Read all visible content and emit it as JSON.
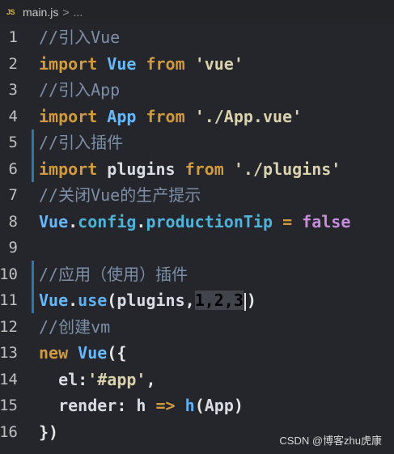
{
  "breadcrumb": {
    "file_icon": "JS",
    "file": "main.js",
    "sep": ">",
    "more": "..."
  },
  "lines": [
    {
      "n": "1",
      "tokens": [
        [
          "cmt",
          "//引入Vue"
        ]
      ]
    },
    {
      "n": "2",
      "tokens": [
        [
          "kw",
          "import"
        ],
        [
          "id",
          " "
        ],
        [
          "cls",
          "Vue"
        ],
        [
          "id",
          " "
        ],
        [
          "kw",
          "from"
        ],
        [
          "id",
          " "
        ],
        [
          "str",
          "'vue'"
        ]
      ]
    },
    {
      "n": "3",
      "tokens": [
        [
          "cmt",
          "//引入App"
        ]
      ]
    },
    {
      "n": "4",
      "tokens": [
        [
          "kw",
          "import"
        ],
        [
          "id",
          " "
        ],
        [
          "cls",
          "App"
        ],
        [
          "id",
          " "
        ],
        [
          "kw",
          "from"
        ],
        [
          "id",
          " "
        ],
        [
          "str",
          "'./App.vue'"
        ]
      ]
    },
    {
      "n": "5",
      "tokens": [
        [
          "cmt",
          "//引入插件"
        ]
      ]
    },
    {
      "n": "6",
      "tokens": [
        [
          "kw",
          "import"
        ],
        [
          "id",
          " "
        ],
        [
          "id",
          "plugins"
        ],
        [
          "id",
          " "
        ],
        [
          "kw",
          "from"
        ],
        [
          "id",
          " "
        ],
        [
          "str",
          "'./plugins'"
        ]
      ]
    },
    {
      "n": "7",
      "tokens": [
        [
          "cmt",
          "//关闭Vue的生产提示"
        ]
      ]
    },
    {
      "n": "8",
      "tokens": [
        [
          "cls",
          "Vue"
        ],
        [
          "pun",
          "."
        ],
        [
          "prop",
          "config"
        ],
        [
          "pun",
          "."
        ],
        [
          "prop",
          "productionTip"
        ],
        [
          "id",
          " "
        ],
        [
          "op",
          "="
        ],
        [
          "id",
          " "
        ],
        [
          "bool",
          "false"
        ]
      ]
    },
    {
      "n": "9",
      "tokens": []
    },
    {
      "n": "10",
      "tokens": [
        [
          "cmt",
          "//应用（使用）插件"
        ]
      ]
    },
    {
      "n": "11",
      "tokens": [
        [
          "cls",
          "Vue"
        ],
        [
          "pun",
          "."
        ],
        [
          "fn",
          "use"
        ],
        [
          "pun",
          "("
        ],
        [
          "id",
          "plugins"
        ],
        [
          "pun",
          ","
        ],
        [
          "sel",
          "1,2,3"
        ],
        [
          "cursor",
          ""
        ],
        [
          "pun",
          ")"
        ]
      ]
    },
    {
      "n": "12",
      "tokens": [
        [
          "cmt",
          "//创建vm"
        ]
      ]
    },
    {
      "n": "13",
      "tokens": [
        [
          "kw",
          "new"
        ],
        [
          "id",
          " "
        ],
        [
          "cls",
          "Vue"
        ],
        [
          "pun",
          "({"
        ]
      ]
    },
    {
      "n": "14",
      "tokens": [
        [
          "id",
          "  el"
        ],
        [
          "pun",
          ":"
        ],
        [
          "str",
          "'#app'"
        ],
        [
          "pun",
          ","
        ]
      ]
    },
    {
      "n": "15",
      "tokens": [
        [
          "id",
          "  render"
        ],
        [
          "pun",
          ":"
        ],
        [
          "id",
          " h "
        ],
        [
          "op",
          "=>"
        ],
        [
          "id",
          " "
        ],
        [
          "fn",
          "h"
        ],
        [
          "pun",
          "("
        ],
        [
          "id",
          "App"
        ],
        [
          "pun",
          ")"
        ]
      ]
    },
    {
      "n": "16",
      "tokens": [
        [
          "pun",
          "})"
        ]
      ]
    }
  ],
  "watermark": "CSDN @博客zhu虎康"
}
